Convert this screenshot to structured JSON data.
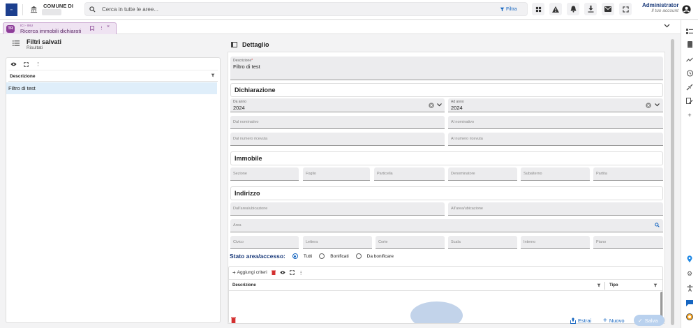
{
  "header": {
    "logo_text": "Comune di Maggioli",
    "municipality_label": "COMUNE DI",
    "search_placeholder": "Cerca in tutte le aree...",
    "filter_label": "Filtra",
    "user_name": "Administrator",
    "user_sub": "Il tuo account"
  },
  "tab": {
    "badge": "TR",
    "subtitle": "ICI - IMU",
    "title": "Ricerca immobili dichiarati"
  },
  "left": {
    "title": "Filtri salvati",
    "subtitle": "Risultati",
    "column": "Descrizione",
    "rows": [
      "Filtro di test"
    ]
  },
  "main": {
    "title": "Dettaglio",
    "descrizione_label": "Descrizione",
    "descrizione_value": "Filtro di test",
    "dichiarazione": {
      "title": "Dichiarazione",
      "da_anno_label": "Da anno",
      "da_anno_value": "2024",
      "ad_anno_label": "Ad anno",
      "ad_anno_value": "2024",
      "dal_nominativo": "Dal nominativo",
      "al_nominativo": "Al nominativo",
      "dal_numero": "Dal numero ricevuta",
      "al_numero": "Al numero ricevuta"
    },
    "immobile": {
      "title": "Immobile",
      "fields": [
        "Sezione",
        "Foglio",
        "Particella",
        "Denominatore",
        "Subalterno",
        "Partita"
      ]
    },
    "indirizzo": {
      "title": "Indirizzo",
      "dall_area": "Dall'area/ubicazione",
      "all_area": "All'area/ubicazione",
      "area": "Area",
      "fields": [
        "Civico",
        "Lettera",
        "Corte",
        "Scala",
        "Interno",
        "Piano"
      ]
    },
    "stato": {
      "title": "Stato area/accesso:",
      "options": [
        "Tutti",
        "Bonificati",
        "Da bonificare"
      ],
      "selected": "Tutti"
    },
    "criteri": {
      "add_label": "Aggiungi criteri",
      "col_descrizione": "Descrizione",
      "col_tipo": "Tipo"
    }
  },
  "footer": {
    "estrai": "Estrai",
    "nuovo": "Nuovo",
    "salva": "Salva"
  },
  "colors": {
    "accent": "#1565c0",
    "tab_purple": "#8e3d9a",
    "danger": "#d32f2f"
  }
}
